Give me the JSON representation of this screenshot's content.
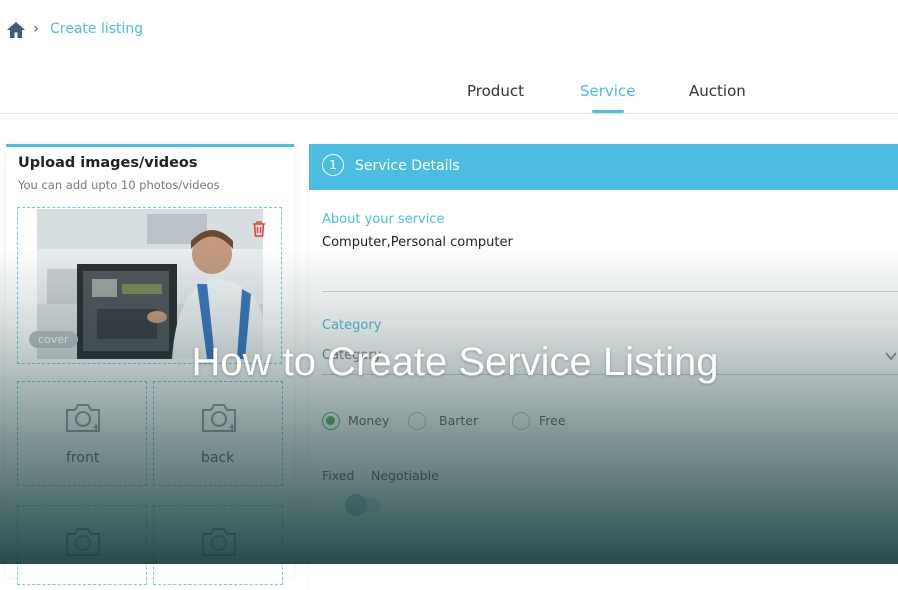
{
  "breadcrumb": {
    "home_icon": "home-icon",
    "separator": "›",
    "current": "Create listing"
  },
  "tabs": [
    {
      "label": "Product",
      "active": false
    },
    {
      "label": "Service",
      "active": true
    },
    {
      "label": "Auction",
      "active": false
    }
  ],
  "upload": {
    "title": "Upload images/videos",
    "subtitle": "You can add upto 10 photos/videos",
    "cover_badge": "cover",
    "slots": [
      {
        "label": "front",
        "icon": "camera-icon"
      },
      {
        "label": "back",
        "icon": "camera-icon"
      },
      {
        "label": "",
        "icon": "camera-icon"
      },
      {
        "label": "",
        "icon": "camera-icon"
      }
    ]
  },
  "details": {
    "step": "1",
    "title": "Service Details",
    "about_label": "About your service",
    "about_value": "Computer,Personal computer",
    "category_label": "Category",
    "category_value": "Category",
    "payment_options": [
      {
        "label": "Money",
        "selected": true
      },
      {
        "label": "Barter",
        "selected": false
      },
      {
        "label": "Free",
        "selected": false
      }
    ],
    "price_fixed": "Fixed",
    "price_negotiable": "Negotiable"
  },
  "headline": "How to Create Service Listing",
  "colors": {
    "accent": "#4bbde0",
    "radio_selected": "#55b36a",
    "overlay": "#143e3e"
  }
}
